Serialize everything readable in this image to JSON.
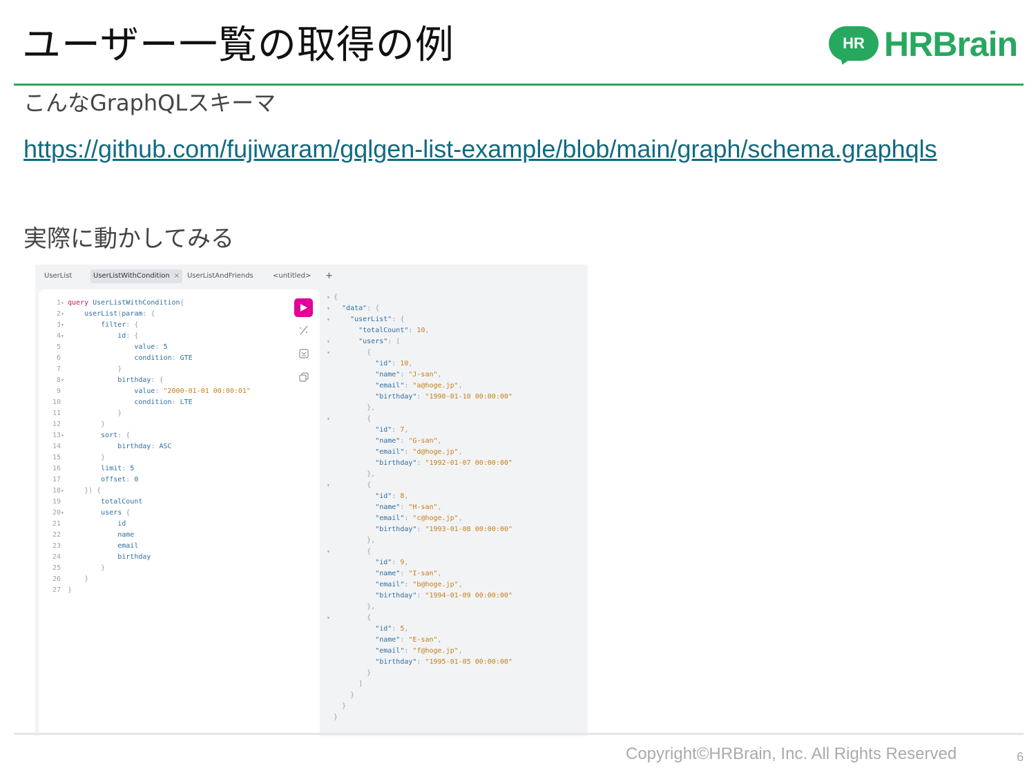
{
  "slide": {
    "title": "ユーザー一覧の取得の例",
    "subtitle": "こんなGraphQLスキーマ",
    "link": "https://github.com/fujiwaram/gqlgen-list-example/blob/main/graph/schema.graphqls",
    "section": "実際に動かしてみる",
    "footer": "Copyright©HRBrain, Inc. All Rights Reserved",
    "page_number": "6"
  },
  "logo": {
    "badge": "HR",
    "word": "HRBrain",
    "brand_color": "#27a85f"
  },
  "tabs": [
    {
      "label": "UserList"
    },
    {
      "label": "UserListWithCondition",
      "active": true,
      "close": "×"
    },
    {
      "label": "UserListAndFriends"
    },
    {
      "label": "<untitled>"
    },
    {
      "label": "+"
    }
  ],
  "editor_lines": [
    {
      "n": "1",
      "fold": true,
      "parts": [
        [
          "kw",
          "query "
        ],
        [
          "fn",
          "UserListWithCondition"
        ],
        [
          "p",
          "{"
        ]
      ]
    },
    {
      "n": "2",
      "fold": true,
      "parts": [
        [
          "fn",
          "    userList"
        ],
        [
          "p",
          "("
        ],
        [
          "fn",
          "param"
        ],
        [
          "p",
          ": {"
        ]
      ]
    },
    {
      "n": "3",
      "fold": true,
      "parts": [
        [
          "fn",
          "        filter"
        ],
        [
          "p",
          ": {"
        ]
      ]
    },
    {
      "n": "4",
      "fold": true,
      "parts": [
        [
          "fn",
          "            id"
        ],
        [
          "p",
          ": {"
        ]
      ]
    },
    {
      "n": "5",
      "fold": false,
      "parts": [
        [
          "fn",
          "                value"
        ],
        [
          "p",
          ": "
        ],
        [
          "fn",
          "5"
        ]
      ]
    },
    {
      "n": "6",
      "fold": false,
      "parts": [
        [
          "fn",
          "                condition"
        ],
        [
          "p",
          ": "
        ],
        [
          "fn",
          "GTE"
        ]
      ]
    },
    {
      "n": "7",
      "fold": false,
      "parts": [
        [
          "p",
          "            }"
        ]
      ]
    },
    {
      "n": "8",
      "fold": true,
      "parts": [
        [
          "fn",
          "            birthday"
        ],
        [
          "p",
          ": {"
        ]
      ]
    },
    {
      "n": "9",
      "fold": false,
      "parts": [
        [
          "fn",
          "                value"
        ],
        [
          "p",
          ": "
        ],
        [
          "str",
          "\"2000-01-01 00:00:01\""
        ]
      ]
    },
    {
      "n": "10",
      "fold": false,
      "parts": [
        [
          "fn",
          "                condition"
        ],
        [
          "p",
          ": "
        ],
        [
          "fn",
          "LTE"
        ]
      ]
    },
    {
      "n": "11",
      "fold": false,
      "parts": [
        [
          "p",
          "            }"
        ]
      ]
    },
    {
      "n": "12",
      "fold": false,
      "parts": [
        [
          "p",
          "        }"
        ]
      ]
    },
    {
      "n": "13",
      "fold": true,
      "parts": [
        [
          "fn",
          "        sort"
        ],
        [
          "p",
          ": {"
        ]
      ]
    },
    {
      "n": "14",
      "fold": false,
      "parts": [
        [
          "fn",
          "            birthday"
        ],
        [
          "p",
          ": "
        ],
        [
          "fn",
          "ASC"
        ]
      ]
    },
    {
      "n": "15",
      "fold": false,
      "parts": [
        [
          "p",
          "        }"
        ]
      ]
    },
    {
      "n": "16",
      "fold": false,
      "parts": [
        [
          "fn",
          "        limit"
        ],
        [
          "p",
          ": "
        ],
        [
          "fn",
          "5"
        ]
      ]
    },
    {
      "n": "17",
      "fold": false,
      "parts": [
        [
          "fn",
          "        offset"
        ],
        [
          "p",
          ": "
        ],
        [
          "fn",
          "0"
        ]
      ]
    },
    {
      "n": "18",
      "fold": true,
      "parts": [
        [
          "p",
          "    }) {"
        ]
      ]
    },
    {
      "n": "19",
      "fold": false,
      "parts": [
        [
          "fn",
          "        totalCount"
        ]
      ]
    },
    {
      "n": "20",
      "fold": true,
      "parts": [
        [
          "fn",
          "        users "
        ],
        [
          "p",
          "{"
        ]
      ]
    },
    {
      "n": "21",
      "fold": false,
      "parts": [
        [
          "fn",
          "            id"
        ]
      ]
    },
    {
      "n": "22",
      "fold": false,
      "parts": [
        [
          "fn",
          "            name"
        ]
      ]
    },
    {
      "n": "23",
      "fold": false,
      "parts": [
        [
          "fn",
          "            email"
        ]
      ]
    },
    {
      "n": "24",
      "fold": false,
      "parts": [
        [
          "fn",
          "            birthday"
        ]
      ]
    },
    {
      "n": "25",
      "fold": false,
      "parts": [
        [
          "p",
          "        }"
        ]
      ]
    },
    {
      "n": "26",
      "fold": false,
      "parts": [
        [
          "p",
          "    }"
        ]
      ]
    },
    {
      "n": "27",
      "fold": false,
      "parts": [
        [
          "p",
          "}"
        ]
      ]
    }
  ],
  "toolbar_icons": [
    "run-icon",
    "prettify-icon",
    "merge-icon",
    "copy-icon"
  ],
  "result_lines": [
    {
      "fold": true,
      "parts": [
        [
          "p",
          "{"
        ]
      ]
    },
    {
      "fold": true,
      "parts": [
        [
          "key",
          "  \"data\""
        ],
        [
          "p",
          ": {"
        ]
      ]
    },
    {
      "fold": true,
      "parts": [
        [
          "key",
          "    \"userList\""
        ],
        [
          "p",
          ": {"
        ]
      ]
    },
    {
      "fold": false,
      "parts": [
        [
          "key",
          "      \"totalCount\""
        ],
        [
          "p",
          ": "
        ],
        [
          "num",
          "10"
        ],
        [
          "p",
          ","
        ]
      ]
    },
    {
      "fold": true,
      "parts": [
        [
          "key",
          "      \"users\""
        ],
        [
          "p",
          ": ["
        ]
      ]
    },
    {
      "fold": true,
      "parts": [
        [
          "p",
          "        {"
        ]
      ]
    },
    {
      "fold": false,
      "parts": [
        [
          "key",
          "          \"id\""
        ],
        [
          "p",
          ": "
        ],
        [
          "num",
          "10"
        ],
        [
          "p",
          ","
        ]
      ]
    },
    {
      "fold": false,
      "parts": [
        [
          "key",
          "          \"name\""
        ],
        [
          "p",
          ": "
        ],
        [
          "str",
          "\"J-san\""
        ],
        [
          "p",
          ","
        ]
      ]
    },
    {
      "fold": false,
      "parts": [
        [
          "key",
          "          \"email\""
        ],
        [
          "p",
          ": "
        ],
        [
          "str",
          "\"a@hoge.jp\""
        ],
        [
          "p",
          ","
        ]
      ]
    },
    {
      "fold": false,
      "parts": [
        [
          "key",
          "          \"birthday\""
        ],
        [
          "p",
          ": "
        ],
        [
          "str",
          "\"1990-01-10 00:00:00\""
        ]
      ]
    },
    {
      "fold": false,
      "parts": [
        [
          "p",
          "        },"
        ]
      ]
    },
    {
      "fold": true,
      "parts": [
        [
          "p",
          "        {"
        ]
      ]
    },
    {
      "fold": false,
      "parts": [
        [
          "key",
          "          \"id\""
        ],
        [
          "p",
          ": "
        ],
        [
          "num",
          "7"
        ],
        [
          "p",
          ","
        ]
      ]
    },
    {
      "fold": false,
      "parts": [
        [
          "key",
          "          \"name\""
        ],
        [
          "p",
          ": "
        ],
        [
          "str",
          "\"G-san\""
        ],
        [
          "p",
          ","
        ]
      ]
    },
    {
      "fold": false,
      "parts": [
        [
          "key",
          "          \"email\""
        ],
        [
          "p",
          ": "
        ],
        [
          "str",
          "\"d@hoge.jp\""
        ],
        [
          "p",
          ","
        ]
      ]
    },
    {
      "fold": false,
      "parts": [
        [
          "key",
          "          \"birthday\""
        ],
        [
          "p",
          ": "
        ],
        [
          "str",
          "\"1992-01-07 00:00:00\""
        ]
      ]
    },
    {
      "fold": false,
      "parts": [
        [
          "p",
          "        },"
        ]
      ]
    },
    {
      "fold": true,
      "parts": [
        [
          "p",
          "        {"
        ]
      ]
    },
    {
      "fold": false,
      "parts": [
        [
          "key",
          "          \"id\""
        ],
        [
          "p",
          ": "
        ],
        [
          "num",
          "8"
        ],
        [
          "p",
          ","
        ]
      ]
    },
    {
      "fold": false,
      "parts": [
        [
          "key",
          "          \"name\""
        ],
        [
          "p",
          ": "
        ],
        [
          "str",
          "\"H-san\""
        ],
        [
          "p",
          ","
        ]
      ]
    },
    {
      "fold": false,
      "parts": [
        [
          "key",
          "          \"email\""
        ],
        [
          "p",
          ": "
        ],
        [
          "str",
          "\"c@hoge.jp\""
        ],
        [
          "p",
          ","
        ]
      ]
    },
    {
      "fold": false,
      "parts": [
        [
          "key",
          "          \"birthday\""
        ],
        [
          "p",
          ": "
        ],
        [
          "str",
          "\"1993-01-08 00:00:00\""
        ]
      ]
    },
    {
      "fold": false,
      "parts": [
        [
          "p",
          "        },"
        ]
      ]
    },
    {
      "fold": true,
      "parts": [
        [
          "p",
          "        {"
        ]
      ]
    },
    {
      "fold": false,
      "parts": [
        [
          "key",
          "          \"id\""
        ],
        [
          "p",
          ": "
        ],
        [
          "num",
          "9"
        ],
        [
          "p",
          ","
        ]
      ]
    },
    {
      "fold": false,
      "parts": [
        [
          "key",
          "          \"name\""
        ],
        [
          "p",
          ": "
        ],
        [
          "str",
          "\"I-san\""
        ],
        [
          "p",
          ","
        ]
      ]
    },
    {
      "fold": false,
      "parts": [
        [
          "key",
          "          \"email\""
        ],
        [
          "p",
          ": "
        ],
        [
          "str",
          "\"b@hoge.jp\""
        ],
        [
          "p",
          ","
        ]
      ]
    },
    {
      "fold": false,
      "parts": [
        [
          "key",
          "          \"birthday\""
        ],
        [
          "p",
          ": "
        ],
        [
          "str",
          "\"1994-01-09 00:00:00\""
        ]
      ]
    },
    {
      "fold": false,
      "parts": [
        [
          "p",
          "        },"
        ]
      ]
    },
    {
      "fold": true,
      "parts": [
        [
          "p",
          "        {"
        ]
      ]
    },
    {
      "fold": false,
      "parts": [
        [
          "key",
          "          \"id\""
        ],
        [
          "p",
          ": "
        ],
        [
          "num",
          "5"
        ],
        [
          "p",
          ","
        ]
      ]
    },
    {
      "fold": false,
      "parts": [
        [
          "key",
          "          \"name\""
        ],
        [
          "p",
          ": "
        ],
        [
          "str",
          "\"E-san\""
        ],
        [
          "p",
          ","
        ]
      ]
    },
    {
      "fold": false,
      "parts": [
        [
          "key",
          "          \"email\""
        ],
        [
          "p",
          ": "
        ],
        [
          "str",
          "\"f@hoge.jp\""
        ],
        [
          "p",
          ","
        ]
      ]
    },
    {
      "fold": false,
      "parts": [
        [
          "key",
          "          \"birthday\""
        ],
        [
          "p",
          ": "
        ],
        [
          "str",
          "\"1995-01-05 00:00:00\""
        ]
      ]
    },
    {
      "fold": false,
      "parts": [
        [
          "p",
          "        }"
        ]
      ]
    },
    {
      "fold": false,
      "parts": [
        [
          "p",
          "      ]"
        ]
      ]
    },
    {
      "fold": false,
      "parts": [
        [
          "p",
          "    }"
        ]
      ]
    },
    {
      "fold": false,
      "parts": [
        [
          "p",
          "  }"
        ]
      ]
    },
    {
      "fold": false,
      "parts": [
        [
          "p",
          "}"
        ]
      ]
    }
  ]
}
